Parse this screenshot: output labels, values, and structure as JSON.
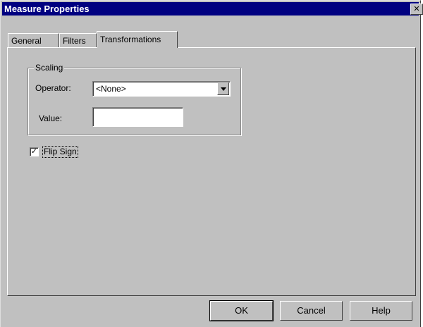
{
  "window": {
    "title": "Measure Properties",
    "close_glyph": "✕"
  },
  "tabs": [
    {
      "label": "General"
    },
    {
      "label": "Filters"
    },
    {
      "label": "Transformations",
      "active": true
    }
  ],
  "scaling": {
    "group_label": "Scaling",
    "operator_label": "Operator:",
    "operator_value": "<None>",
    "value_label": "Value:",
    "value": ""
  },
  "flip_sign": {
    "label": "Flip Sign",
    "checked": true,
    "check_glyph": "✓"
  },
  "buttons": {
    "ok": "OK",
    "cancel": "Cancel",
    "help": "Help"
  }
}
